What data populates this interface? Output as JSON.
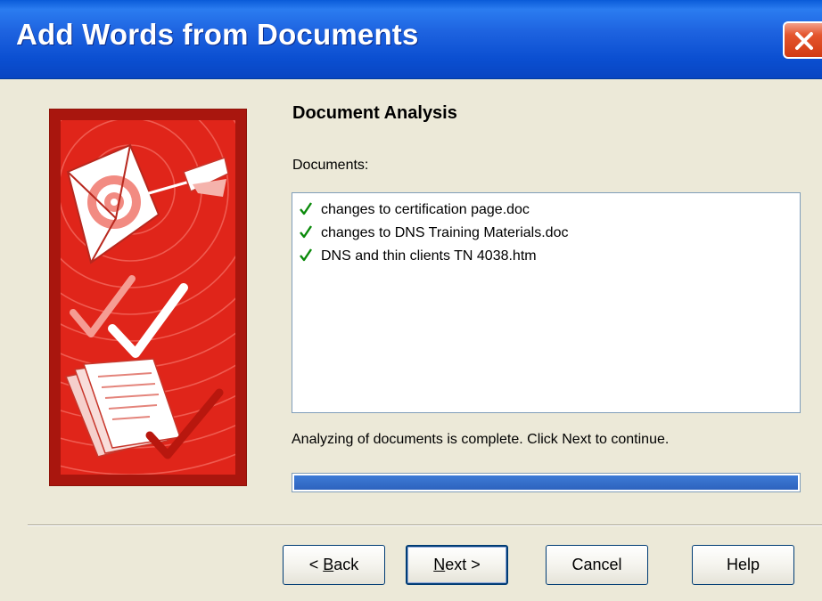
{
  "window": {
    "title": "Add Words from Documents"
  },
  "page": {
    "heading": "Document Analysis",
    "documents_label": "Documents:"
  },
  "documents": [
    {
      "name": "changes to certification page.doc",
      "status": "checked"
    },
    {
      "name": "changes to DNS Training Materials.doc",
      "status": "checked"
    },
    {
      "name": "DNS and thin clients TN 4038.htm",
      "status": "checked"
    }
  ],
  "status_text": "Analyzing of documents is complete. Click Next to continue.",
  "progress": {
    "fraction": 1.0
  },
  "buttons": {
    "back": {
      "prefix": "< ",
      "mnemonic": "B",
      "rest": "ack"
    },
    "next": {
      "mnemonic": "N",
      "rest": "ext >"
    },
    "cancel": "Cancel",
    "help": "Help"
  },
  "colors": {
    "titlebar": "#0B4FD1",
    "art_background": "#BE1E14",
    "check": "#0A8A0A",
    "progress": "#3D7BD6"
  },
  "icons": {
    "close": "close-icon",
    "check": "check-icon"
  }
}
